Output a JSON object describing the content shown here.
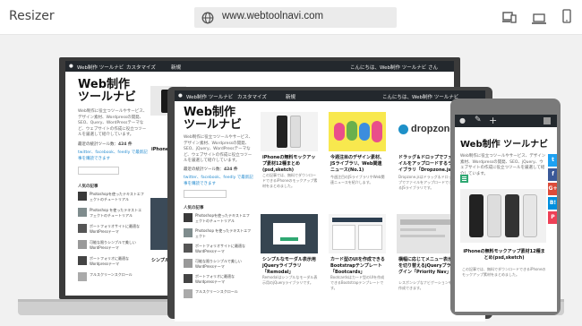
{
  "header": {
    "app_title": "Resizer",
    "url": "www.webtoolnavi.com"
  },
  "icons": {
    "globe": "globe-icon",
    "desktop_tablet": "devices-icon",
    "laptop": "laptop-icon",
    "phone": "smartphone-icon"
  },
  "laptop": {
    "adminbar_left": "Web制作 ツールナビ",
    "adminbar_custom": "カスタマイズ",
    "adminbar_new": "新規",
    "adminbar_right": "こんにちは、Web制作 ツールナビ さん",
    "site_title_1": "Web制作",
    "site_title_2": "ツールナビ",
    "desc": "Web制作に役立つツールやサービス、デザイン素材、Wordpressの開発、SEO、Query、WordPressテーマなど、ウェブサイトの作成に役立つツールを厳選して紹介しています。",
    "recent": "最近の統計ツール数：",
    "recent_count": "424 件",
    "follow": "twitter、facebook、feedly で最新記事を購読できます",
    "popular": "人気の記事",
    "sidebar_items": [
      "Photoshopを使ったテキストエフェクトのチュートリアル",
      "Photoshop を使ったテキストエフェクトのチュートリアル",
      "ポートフォリオサイトに最適なWordPressテーマ",
      "可能な限りシンプルで美しいWordPressテーマ",
      "ポートフォリオに最適なWordpressテーマ",
      "フルスクリーンスクロール"
    ],
    "card_titles": [
      "iPhone",
      "シンプル"
    ]
  },
  "tablet": {
    "adminbar_left": "Web制作 ツールナビ",
    "adminbar_custom": "カスタマイズ",
    "adminbar_new": "新規",
    "adminbar_right": "こんにちは、Web制作 ツールナビ",
    "site_title_1": "Web制作",
    "site_title_2": "ツールナビ",
    "desc": "Web制作に役立つツールやサービス、デザイン素材、Wordpressの開発、SEO、jQuery、WordPressテーマなど、ウェブサイトの作成に役立つツールを厳選して紹介しています。",
    "recent": "最近の統計ツール数：",
    "recent_count": "424 件",
    "follow": "twitter、facebook、feedly で最新記事を購読できます",
    "popular": "人気の記事",
    "sidebar_items": [
      "Photoshopを使ったテキストエフェクトのチュートリアル",
      "Photoshop を使ったテキストエフェクト",
      "ポートフォリオサイトに最適なWordPressテーマ",
      "可能な限りシンプルで美しいWordPressテーマ",
      "ポートフォリオに最適なWordpressテーマ",
      "フルスクリーンスクロール"
    ],
    "cards": [
      {
        "title": "iPhoneの無料モックアップ素材12種まとめ(psd,sketch)",
        "text": "この記事では、無料でダウンロードできるiPhoneのモックアップ素材をまとめました。"
      },
      {
        "title": "今週注目のデザイン素材、JSライブラリ、Web関連ニュース(No.1)",
        "text": "今週注目のJSライブラリやWeb関連ニュースを紹介します。"
      },
      {
        "title": "ドラッグ＆ドロップでファイルをアップロードするライブラリ「Dropzone.js」",
        "text": "Dropzone.jsはドラッグ＆ドロップでファイルをアップロードできるJSライブラリです。"
      },
      {
        "title": "シンプルなモーダル表示用jQueryライブラリ「Remodal」",
        "text": "Remodalはシンプルなモーダル表示用のjQueryライブラリです。"
      },
      {
        "title": "カード型のUIを作成できるBootstrapテンプレート「Bootcards」",
        "text": "Bootcardsはカード型のUIを作成できるBootstrapテンプレートです。"
      },
      {
        "title": "横幅に応じてメニュー表示を切り替えるjQueryプラグイン「Priority Nav」",
        "text": "レスポンシブなナビゲーションを作成できます。"
      }
    ],
    "card_img_labels": [
      "dropzone"
    ]
  },
  "phone": {
    "site_title": "Web制作 ツールナビ",
    "desc": "Web制作に役立つツールやサービス、デザイン素材、Wordpressの開発、SEO、jQuery、ウェブサイトの作成に役立つツールを厳選して紹介しています。",
    "card_title": "iPhoneの無料モックアップ素材12種まとめ(psd,sketch)",
    "card_text": "この記事では、無料でダウンロードできるiPhoneのモックアップ素材をまとめました。",
    "share_labels": [
      "t",
      "f",
      "G+",
      "B!",
      "P"
    ],
    "share_colors": [
      "#1da1f2",
      "#3b5998",
      "#dd4b39",
      "#008fde",
      "#ee4056"
    ]
  },
  "colors": {
    "accent_green": "#2fa872",
    "adminbar": "#23282d",
    "link": "#2a8ed0"
  }
}
